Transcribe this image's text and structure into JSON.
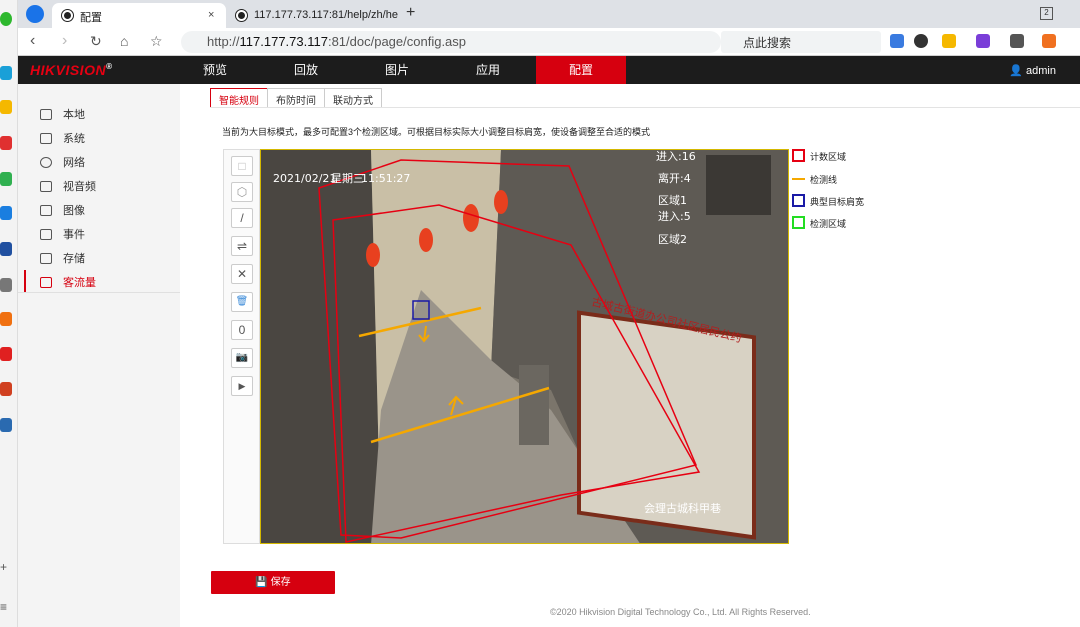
{
  "browser": {
    "tabs": [
      {
        "label": "配置"
      },
      {
        "label": "117.177.73.117:81/help/zh/he"
      }
    ],
    "url_prefix": "http://",
    "url_host": "117.177.73.117",
    "url_path": ":81/doc/page/config.asp",
    "search_placeholder": "点此搜索"
  },
  "header": {
    "logo": "HIKVISION",
    "logo_mark": "®",
    "menu": [
      {
        "label": "预览"
      },
      {
        "label": "回放"
      },
      {
        "label": "图片"
      },
      {
        "label": "应用"
      },
      {
        "label": "配置"
      }
    ],
    "user": "admin"
  },
  "sidebar": {
    "items": [
      {
        "label": "本地",
        "icon": "monitor-icon"
      },
      {
        "label": "系统",
        "icon": "system-icon"
      },
      {
        "label": "网络",
        "icon": "globe-icon"
      },
      {
        "label": "视音频",
        "icon": "video-audio-icon"
      },
      {
        "label": "图像",
        "icon": "image-icon"
      },
      {
        "label": "事件",
        "icon": "calendar-icon"
      },
      {
        "label": "存储",
        "icon": "save-icon"
      },
      {
        "label": "客流量",
        "icon": "people-counting-icon"
      }
    ]
  },
  "subtabs": [
    {
      "label": "智能规则"
    },
    {
      "label": "布防时间"
    },
    {
      "label": "联动方式"
    }
  ],
  "info_text": "当前为大目标模式，最多可配置3个检测区域。可根据目标实际大小调整目标肩宽，使设备调整至合适的模式",
  "toolbox": [
    {
      "name": "rectangle-tool-button",
      "glyph": "□"
    },
    {
      "name": "polygon-tool-button",
      "glyph": "⬡"
    },
    {
      "name": "line-tool-button",
      "glyph": "/"
    },
    {
      "name": "swap-direction-button",
      "glyph": "⇌"
    },
    {
      "name": "delete-button",
      "glyph": "✕"
    },
    {
      "name": "trash-button",
      "glyph": "🗑"
    },
    {
      "name": "reset-count-button",
      "glyph": "0"
    },
    {
      "name": "snapshot-button",
      "glyph": "📷"
    },
    {
      "name": "record-button",
      "glyph": "▶"
    }
  ],
  "video": {
    "timestamp_date": "2021/02/21",
    "timestamp_weekday": "星期三",
    "timestamp_time": "11:51:27",
    "osd_lines": [
      "进入:16",
      "离开:4",
      "区域1",
      "进入:5",
      "区域2"
    ],
    "camera_name": "会理古城科甲巷",
    "sign_text": "古城古街道办公司社区居民公约"
  },
  "legend": [
    {
      "label": "计数区域",
      "color": "#e60012",
      "kind": "box"
    },
    {
      "label": "检测线",
      "color": "#f5a800",
      "kind": "line"
    },
    {
      "label": "典型目标肩宽",
      "color": "#1a1aa6",
      "kind": "box"
    },
    {
      "label": "检测区域",
      "color": "#22dd22",
      "kind": "box"
    }
  ],
  "save_label": "保存",
  "footer": "©2020 Hikvision Digital Technology Co., Ltd. All Rights Reserved."
}
